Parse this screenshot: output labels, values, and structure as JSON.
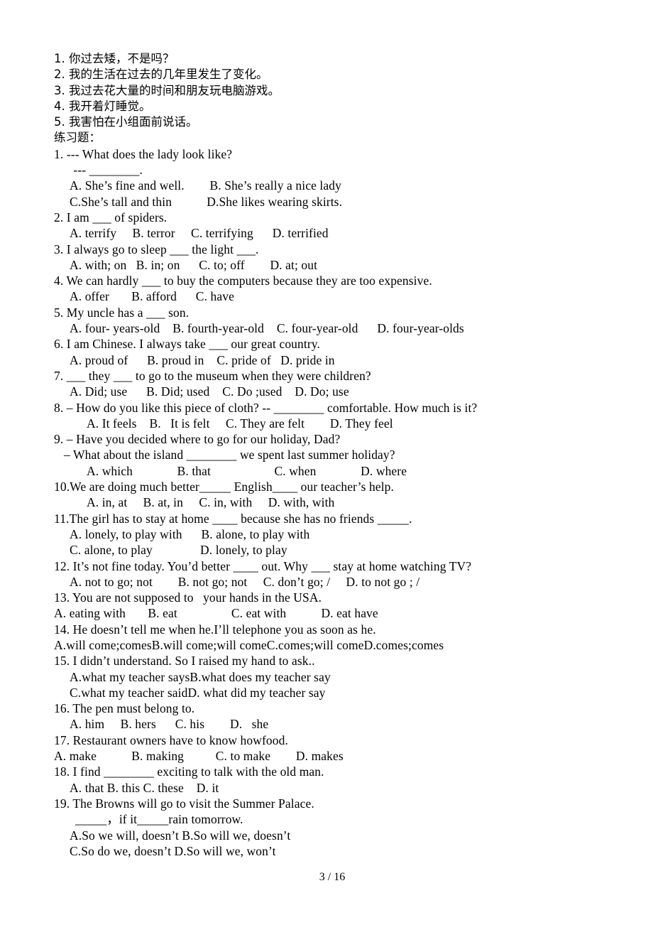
{
  "document": {
    "translation_section": {
      "lines": [
        "1. 你过去矮，不是吗？",
        "2. 我的生活在过去的几年里发生了变化。",
        "3. 我过去花大量的时间和朋友玩电脑游戏。",
        "4. 我开着灯睡觉。",
        "5. 我害怕在小组面前说话。"
      ]
    },
    "exercise_heading": "练习题：",
    "questions": [
      {
        "number": "1.",
        "stem": "1. --- What does the lady look like?",
        "stem_indent": "i0",
        "extra_lines": [
          {
            "text": "   --- ________.",
            "indent": "i1"
          }
        ],
        "option_lines": [
          {
            "text": "A. She’s fine and well.        B. She’s really a nice lady",
            "indent": "i2"
          },
          {
            "text": "C.She’s tall and thin           D.She likes wearing skirts.",
            "indent": "i2"
          }
        ]
      },
      {
        "number": "2.",
        "stem": "2. I am ___ of spiders.",
        "stem_indent": "i0",
        "extra_lines": [],
        "option_lines": [
          {
            "text": "A. terrify     B. terror     C. terrifying      D. terrified",
            "indent": "i2"
          }
        ]
      },
      {
        "number": "3.",
        "stem": "3. I always go to sleep ___ the light ___.",
        "stem_indent": "i0",
        "extra_lines": [],
        "option_lines": [
          {
            "text": "A. with; on   B. in; on      C. to; off        D. at; out",
            "indent": "i2"
          }
        ]
      },
      {
        "number": "4.",
        "stem": "4. We can hardly ___ to buy the computers because they are too expensive.",
        "stem_indent": "i0",
        "extra_lines": [],
        "option_lines": [
          {
            "text": "A. offer       B. afford      C. have",
            "indent": "i2"
          }
        ]
      },
      {
        "number": "5.",
        "stem": "5. My uncle has a ___ son.",
        "stem_indent": "i0",
        "extra_lines": [],
        "option_lines": [
          {
            "text": "A. four- years-old    B. fourth-year-old    C. four-year-old      D. four-year-olds",
            "indent": "i2"
          }
        ]
      },
      {
        "number": "6.",
        "stem": "6. I am Chinese. I always take ___ our great country.",
        "stem_indent": "i0",
        "extra_lines": [],
        "option_lines": [
          {
            "text": "A. proud of      B. proud in    C. pride of   D. pride in",
            "indent": "i2"
          }
        ]
      },
      {
        "number": "7.",
        "stem": "7. ___ they ___ to go to the museum when they were children?",
        "stem_indent": "i0",
        "extra_lines": [],
        "option_lines": [
          {
            "text": "A. Did; use      B. Did; used    C. Do ;used    D. Do; use",
            "indent": "i2"
          }
        ]
      },
      {
        "number": "8.",
        "stem": "8. – How do you like this piece of cloth? -- ________ comfortable. How much is it?",
        "stem_indent": "i0",
        "extra_lines": [],
        "option_lines": [
          {
            "text": "A. It feels    B.   It is felt     C. They are felt        D. They feel",
            "indent": "i4"
          }
        ]
      },
      {
        "number": "9.",
        "stem": "9. – Have you decided where to go for our holiday, Dad?",
        "stem_indent": "i0",
        "extra_lines": [
          {
            "text": "– What about the island ________ we spent last summer holiday?",
            "indent": "i1"
          }
        ],
        "option_lines": [
          {
            "text": "A. which              B. that                    C. when              D. where",
            "indent": "i4"
          }
        ]
      },
      {
        "number": "10.",
        "stem": "10.We are doing much better_____ English____ our teacher’s help.",
        "stem_indent": "i0",
        "extra_lines": [],
        "option_lines": [
          {
            "text": "A. in, at     B. at, in     C. in, with     D. with, with",
            "indent": "i4"
          }
        ]
      },
      {
        "number": "11.",
        "stem": "11.The girl has to stay at home ____ because she has no friends _____.",
        "stem_indent": "i0",
        "extra_lines": [],
        "option_lines": [
          {
            "text": "A. lonely, to play with      B. alone, to play with",
            "indent": "i2"
          },
          {
            "text": "C. alone, to play               D. lonely, to play",
            "indent": "i2"
          }
        ]
      },
      {
        "number": "12.",
        "stem": "12. It’s not fine today. You’d better ____ out. Why ___ stay at home watching TV?",
        "stem_indent": "i0",
        "extra_lines": [],
        "option_lines": [
          {
            "text": "A. not to go; not        B. not go; not     C. don’t go; /     D. to not go ; /",
            "indent": "i2"
          }
        ]
      },
      {
        "number": "13.",
        "stem": "13. You are not supposed to   your hands in the USA.",
        "stem_indent": "i0",
        "extra_lines": [],
        "option_lines": [
          {
            "text": "A. eating with       B. eat                 C. eat with           D. eat have",
            "indent": "i0"
          }
        ]
      },
      {
        "number": "14.",
        "stem": "14. He doesn’t tell me when he.I’ll telephone you as soon as he.",
        "stem_indent": "i0",
        "extra_lines": [],
        "option_lines": [
          {
            "text": "A.will come;comesB.will come;will comeC.comes;will comeD.comes;comes",
            "indent": "i0"
          }
        ]
      },
      {
        "number": "15.",
        "stem": "15. I didn’t understand. So I raised my hand to ask..",
        "stem_indent": "i0",
        "extra_lines": [],
        "option_lines": [
          {
            "text": "A.what my teacher saysB.what does my teacher say",
            "indent": "i2"
          },
          {
            "text": "C.what my teacher saidD. what did my teacher say",
            "indent": "i2"
          }
        ]
      },
      {
        "number": "16.",
        "stem": "16. The pen must belong to.",
        "stem_indent": "i0",
        "extra_lines": [],
        "option_lines": [
          {
            "text": "A. him     B. hers      C. his        D.   she",
            "indent": "i2"
          }
        ]
      },
      {
        "number": "17.",
        "stem": "17. Restaurant owners have to know howfood.",
        "stem_indent": "i0",
        "extra_lines": [],
        "option_lines": [
          {
            "text": "A. make           B. making          C. to make        D. makes",
            "indent": "i0"
          }
        ]
      },
      {
        "number": "18.",
        "stem": "18. I find ________ exciting to talk with the old man.",
        "stem_indent": "i0",
        "extra_lines": [],
        "option_lines": [
          {
            "text": "A. that B. this C. these    D. it",
            "indent": "i2"
          }
        ]
      },
      {
        "number": "19.",
        "stem": "19. The Browns will go to visit the Summer Palace.",
        "stem_indent": "i0",
        "extra_lines": [
          {
            "text": "_____，if it_____rain tomorrow.",
            "indent": "i3"
          }
        ],
        "option_lines": [
          {
            "text": "A.So we will, doesn’t B.So will we, doesn’t",
            "indent": "i2"
          },
          {
            "text": "C.So do we, doesn’t D.So will we, won’t",
            "indent": "i2"
          }
        ]
      }
    ],
    "footer": {
      "page_number": "3",
      "separator": "/",
      "total_pages": "16"
    }
  }
}
